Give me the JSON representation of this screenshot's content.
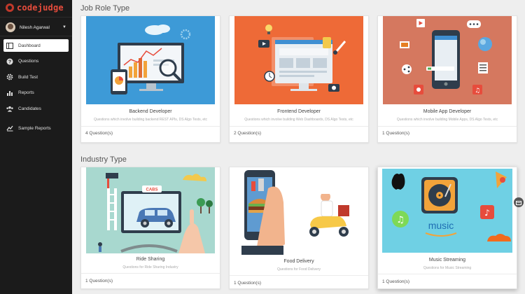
{
  "app": {
    "brand": "codejudge"
  },
  "user": {
    "name": "Nilesh Agarwal"
  },
  "sidebar": {
    "items": [
      {
        "label": "Dashboard",
        "icon": "dashboard-icon",
        "active": true
      },
      {
        "label": "Questions",
        "icon": "help-icon"
      },
      {
        "label": "Build Test",
        "icon": "settings-icon"
      },
      {
        "label": "Reports",
        "icon": "bar-chart-icon"
      },
      {
        "label": "Candidates",
        "icon": "users-icon"
      },
      {
        "label": "Sample Reports",
        "icon": "line-chart-icon"
      }
    ]
  },
  "sections": [
    {
      "title": "Job Role Type",
      "cards": [
        {
          "title": "Backend Developer",
          "desc": "Questions which involve building backend REST APIs, DS Algo Tests, etc",
          "count": "4 Question(s)",
          "color": "#3d9ad7"
        },
        {
          "title": "Frontend Developer",
          "desc": "Questions which involve building Web Dashboards, DS Algo Tests, etc",
          "count": "2 Question(s)",
          "color": "#ee6a37"
        },
        {
          "title": "Mobile App Developer",
          "desc": "Questions which involve building Mobile Apps, DS Algo Tests, etc",
          "count": "1 Question(s)",
          "color": "#d5785f"
        }
      ]
    },
    {
      "title": "Industry Type",
      "cards": [
        {
          "title": "Ride Sharing",
          "desc": "Questions for Ride Sharing Industry",
          "count": "1 Question(s)",
          "color": "#a8d8cf"
        },
        {
          "title": "Food Delivery",
          "desc": "Questions for Food Delivery",
          "count": "1 Question(s)",
          "color": "#ffffff"
        },
        {
          "title": "Music Streaming",
          "desc": "Questions for Music Streaming",
          "count": "1 Question(s)",
          "color": "#6fd0e4"
        }
      ]
    }
  ],
  "illustration_text": {
    "ride_sign": "CABS",
    "music_word": "music"
  }
}
